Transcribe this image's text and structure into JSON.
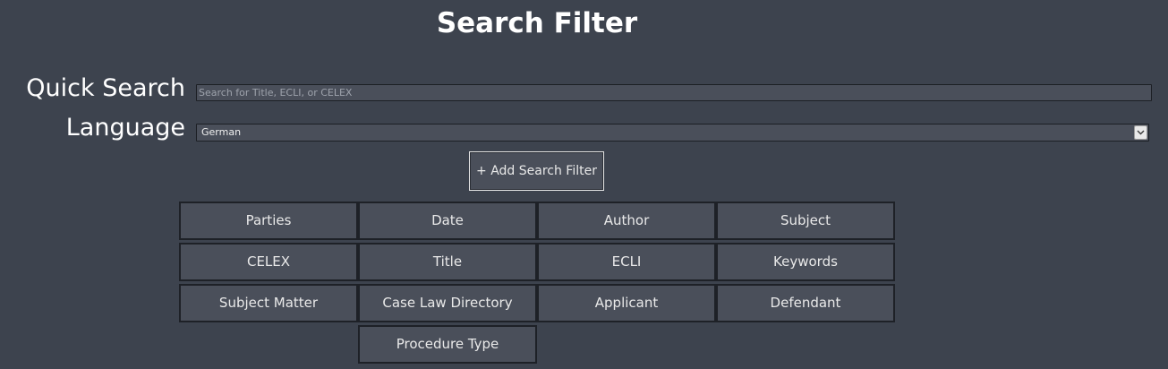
{
  "page": {
    "title": "Search Filter"
  },
  "quick_search": {
    "label": "Quick Search",
    "placeholder": "Search for Title, ECLI, or CELEX",
    "value": ""
  },
  "language": {
    "label": "Language",
    "selected": "German",
    "arrow_icon": "chevron-down-icon"
  },
  "add_filter": {
    "label": "+ Add Search Filter"
  },
  "filters": [
    "Parties",
    "Date",
    "Author",
    "Subject",
    "CELEX",
    "Title",
    "ECLI",
    "Keywords",
    "Subject Matter",
    "Case Law Directory",
    "Applicant",
    "Defendant",
    "Procedure Type"
  ],
  "colors": {
    "background": "#3d434e",
    "control_background": "#4a4f5a",
    "control_border": "#1e2127",
    "text": "#ffffff"
  }
}
